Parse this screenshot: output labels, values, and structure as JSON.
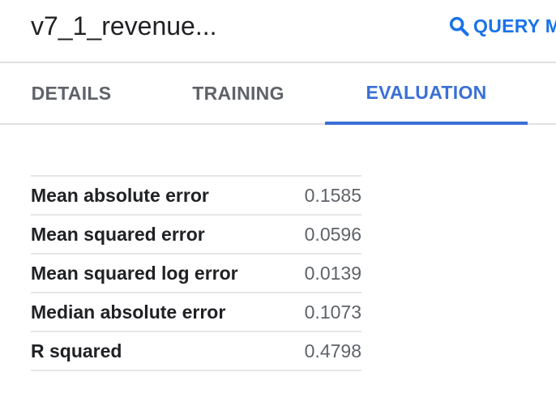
{
  "header": {
    "title": "v7_1_revenue...",
    "query_button_label": "QUERY M"
  },
  "tabs": [
    {
      "label": "DETAILS",
      "active": false
    },
    {
      "label": "TRAINING",
      "active": false
    },
    {
      "label": "EVALUATION",
      "active": true
    }
  ],
  "metrics": [
    {
      "name": "Mean absolute error",
      "value": "0.1585"
    },
    {
      "name": "Mean squared error",
      "value": "0.0596"
    },
    {
      "name": "Mean squared log error",
      "value": "0.0139"
    },
    {
      "name": "Median absolute error",
      "value": "0.1073"
    },
    {
      "name": "R squared",
      "value": "0.4798"
    }
  ],
  "colors": {
    "accent": "#3b6fd6",
    "link": "#1a73e8",
    "text": "#202124",
    "muted": "#5f6368",
    "divider": "#e0e0e0"
  }
}
